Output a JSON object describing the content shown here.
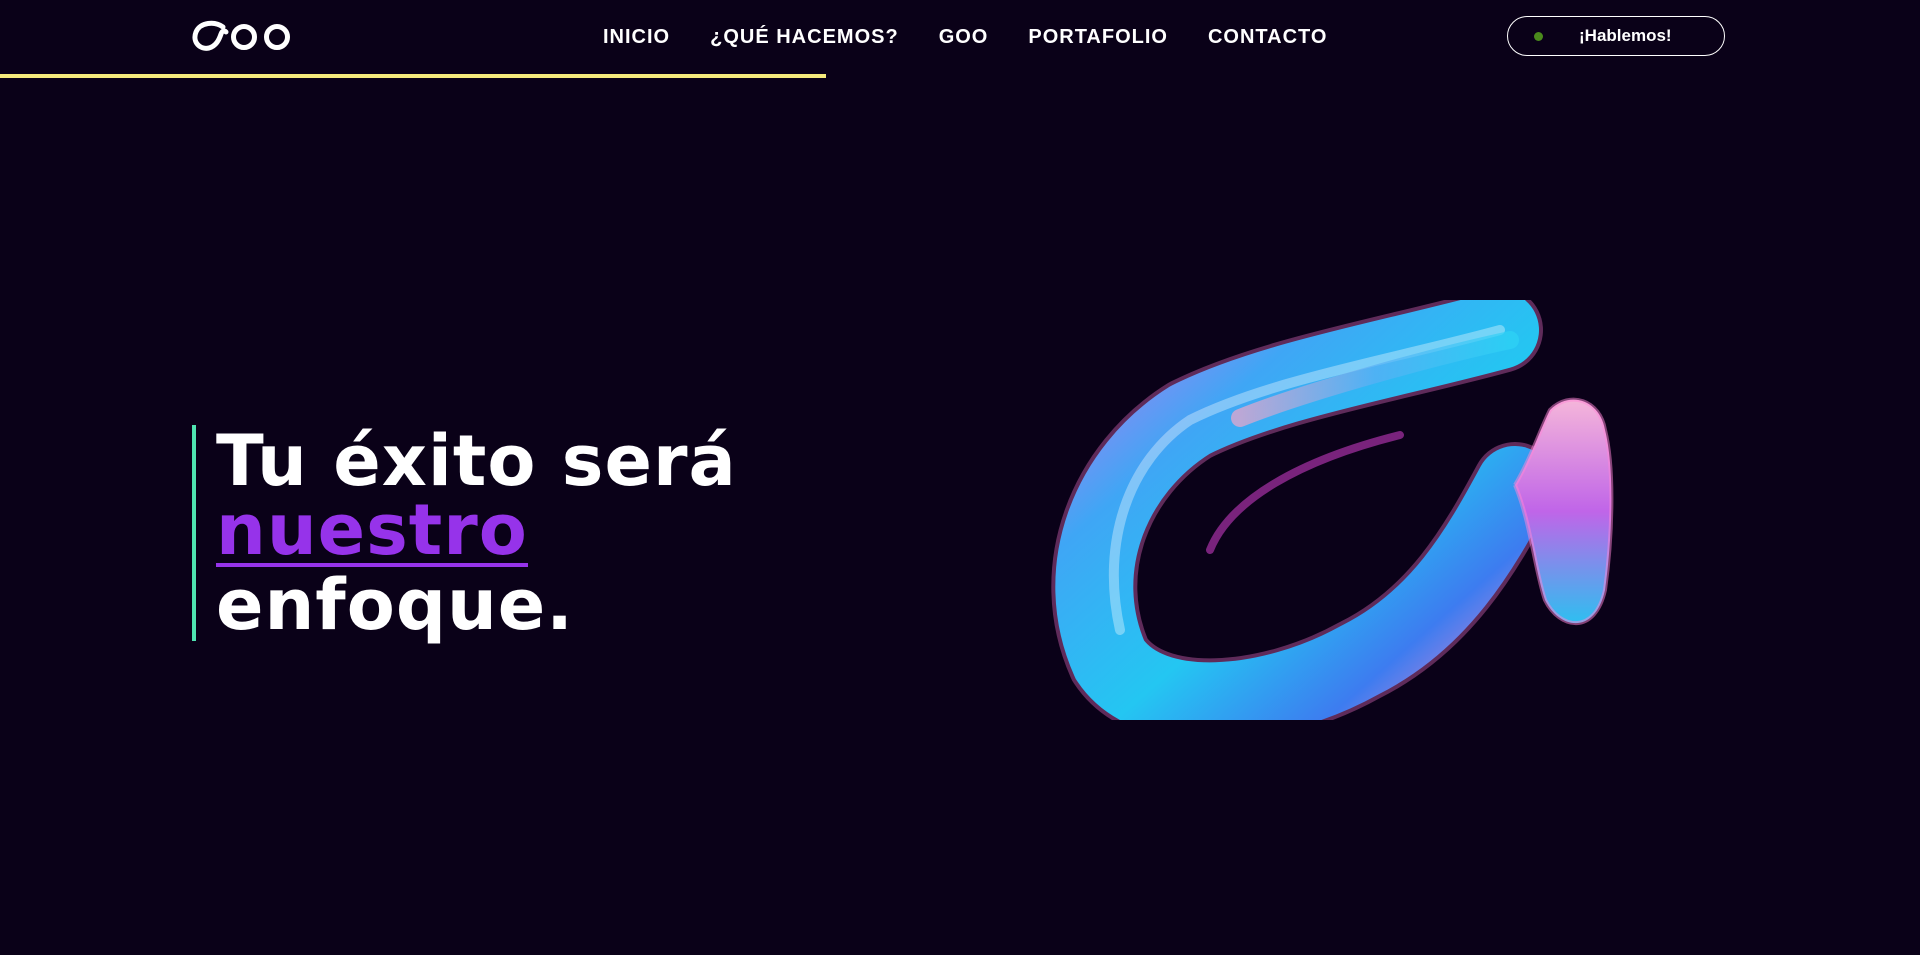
{
  "brand": {
    "logo_text": "GOO"
  },
  "nav": {
    "items": [
      {
        "label": "INICIO"
      },
      {
        "label": "¿QUÉ HACEMOS?"
      },
      {
        "label": "GOO"
      },
      {
        "label": "PORTAFOLIO"
      },
      {
        "label": "CONTACTO"
      }
    ]
  },
  "cta": {
    "label": "¡Hablemos!",
    "dot_color": "#4a8a1c"
  },
  "scroll_progress": {
    "percent": 43,
    "color": "#f5ea7c"
  },
  "hero": {
    "line1": "Tu éxito será",
    "line2": "nuestro",
    "line3": "enfoque.",
    "accent_color": "#9633ea",
    "rule_color": "#4fe3b0"
  },
  "graphic": {
    "icon": "iridescent-3d-logo-mark"
  },
  "colors": {
    "background": "#0a0118",
    "text": "#ffffff"
  }
}
